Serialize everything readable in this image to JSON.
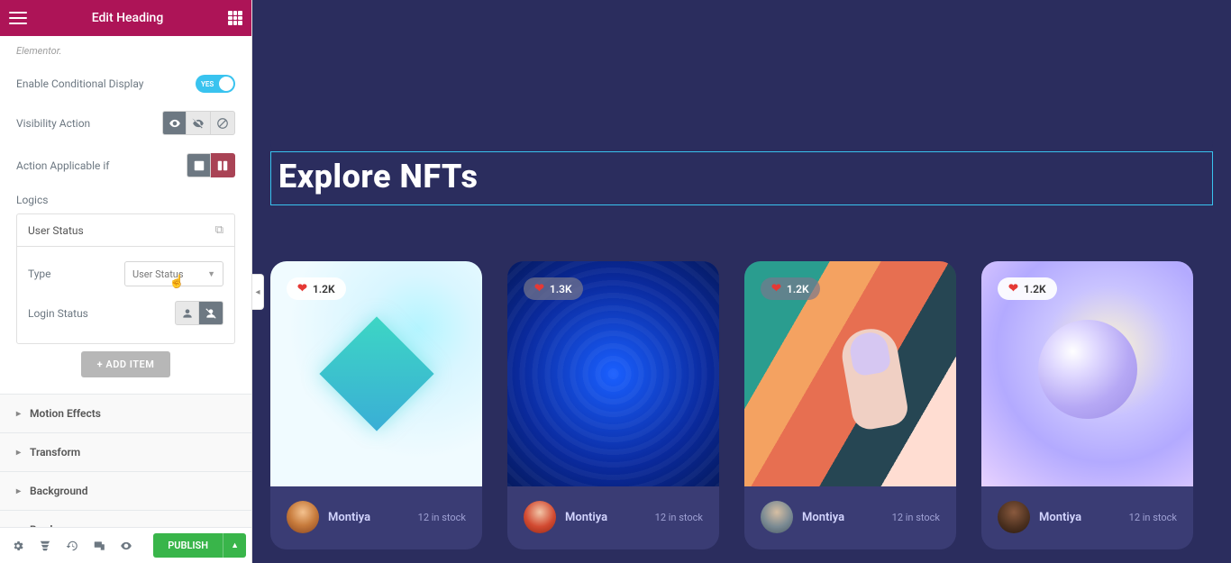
{
  "topbar": {
    "title": "Edit Heading"
  },
  "panel": {
    "help_text": "Elementor.",
    "enable_cond_label": "Enable Conditional Display",
    "enable_cond_on": "YES",
    "visibility_label": "Visibility Action",
    "applicable_label": "Action Applicable if",
    "logics_label": "Logics",
    "repeater": {
      "title": "User Status",
      "type_label": "Type",
      "type_value": "User Status",
      "login_label": "Login Status"
    },
    "add_item": "ADD ITEM",
    "sections": [
      "Motion Effects",
      "Transform",
      "Background",
      "Border"
    ]
  },
  "footer": {
    "publish": "PUBLISH"
  },
  "preview": {
    "heading": "Explore NFTs",
    "cards": [
      {
        "likes": "1.2K",
        "author": "Montiya",
        "stock": "12 in stock"
      },
      {
        "likes": "1.3K",
        "author": "Montiya",
        "stock": "12 in stock"
      },
      {
        "likes": "1.2K",
        "author": "Montiya",
        "stock": "12 in stock"
      },
      {
        "likes": "1.2K",
        "author": "Montiya",
        "stock": "12 in stock"
      }
    ]
  }
}
